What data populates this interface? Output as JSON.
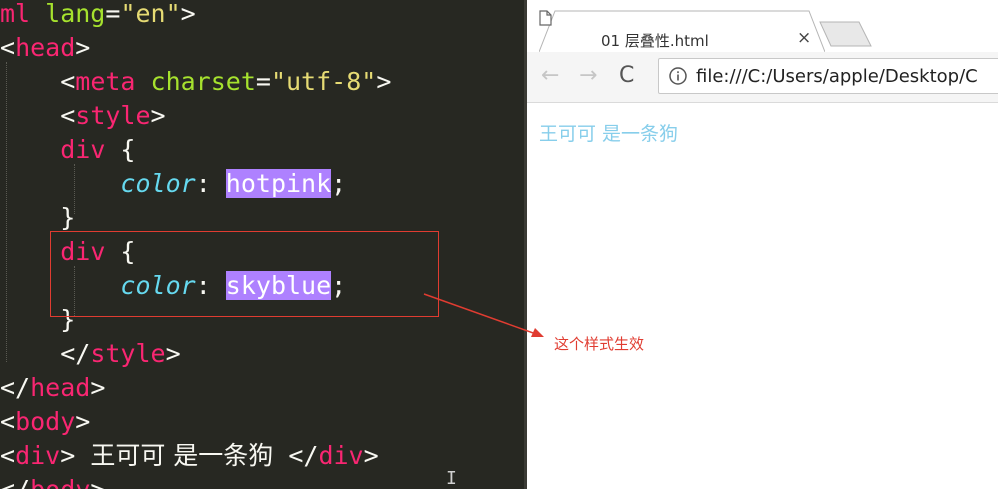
{
  "editor": {
    "lines": [
      [
        {
          "t": "ml ",
          "c": "tag"
        },
        {
          "t": "lang",
          "c": "attr"
        },
        {
          "t": "=",
          "c": "punct"
        },
        {
          "t": "\"en\"",
          "c": "str"
        },
        {
          "t": ">",
          "c": "punct"
        }
      ],
      [
        {
          "t": "<",
          "c": "punct"
        },
        {
          "t": "head",
          "c": "tag"
        },
        {
          "t": ">",
          "c": "punct"
        }
      ],
      [
        {
          "t": "    <",
          "c": "punct"
        },
        {
          "t": "meta ",
          "c": "tag"
        },
        {
          "t": "charset",
          "c": "attr"
        },
        {
          "t": "=",
          "c": "punct"
        },
        {
          "t": "\"utf-8\"",
          "c": "str"
        },
        {
          "t": ">",
          "c": "punct"
        }
      ],
      [
        {
          "t": "    <",
          "c": "punct"
        },
        {
          "t": "style",
          "c": "tag"
        },
        {
          "t": ">",
          "c": "punct"
        }
      ],
      [
        {
          "t": "    ",
          "c": "punct"
        },
        {
          "t": "div",
          "c": "tag"
        },
        {
          "t": " {",
          "c": "punct"
        }
      ],
      [
        {
          "t": "        ",
          "c": "punct"
        },
        {
          "t": "color",
          "c": "prop"
        },
        {
          "t": ": ",
          "c": "punct"
        },
        {
          "t": "hotpink",
          "c": "val"
        },
        {
          "t": ";",
          "c": "punct"
        }
      ],
      [
        {
          "t": "    }",
          "c": "punct"
        }
      ],
      [
        {
          "t": "    ",
          "c": "punct"
        },
        {
          "t": "div",
          "c": "tag"
        },
        {
          "t": " {",
          "c": "punct"
        }
      ],
      [
        {
          "t": "        ",
          "c": "punct"
        },
        {
          "t": "color",
          "c": "prop"
        },
        {
          "t": ": ",
          "c": "punct"
        },
        {
          "t": "skyblue",
          "c": "val"
        },
        {
          "t": ";",
          "c": "punct"
        }
      ],
      [
        {
          "t": "    }",
          "c": "punct"
        }
      ],
      [
        {
          "t": "    </",
          "c": "punct"
        },
        {
          "t": "style",
          "c": "tag"
        },
        {
          "t": ">",
          "c": "punct"
        }
      ],
      [
        {
          "t": "</",
          "c": "punct"
        },
        {
          "t": "head",
          "c": "tag"
        },
        {
          "t": ">",
          "c": "punct"
        }
      ],
      [
        {
          "t": "<",
          "c": "punct"
        },
        {
          "t": "body",
          "c": "tag"
        },
        {
          "t": ">",
          "c": "punct"
        }
      ],
      [
        {
          "t": "<",
          "c": "punct"
        },
        {
          "t": "div",
          "c": "tag"
        },
        {
          "t": "> ",
          "c": "punct"
        },
        {
          "t": "王可可 是一条狗",
          "c": "cjk"
        },
        {
          "t": " </",
          "c": "punct"
        },
        {
          "t": "div",
          "c": "tag"
        },
        {
          "t": ">",
          "c": "punct"
        }
      ],
      [
        {
          "t": "</",
          "c": "punct"
        },
        {
          "t": "body",
          "c": "tag"
        },
        {
          "t": ">",
          "c": "punct"
        }
      ]
    ]
  },
  "browser": {
    "tab_title": "01 层叠性.html",
    "tab_close": "×",
    "back_icon": "←",
    "forward_icon": "→",
    "reload_icon": "C",
    "url": "file:///C:/Users/apple/Desktop/C",
    "page_text": "王可可 是一条狗",
    "page_text_color": "#87ceeb"
  },
  "annotation": {
    "text": "这个样式生效",
    "color": "#e03c31"
  }
}
